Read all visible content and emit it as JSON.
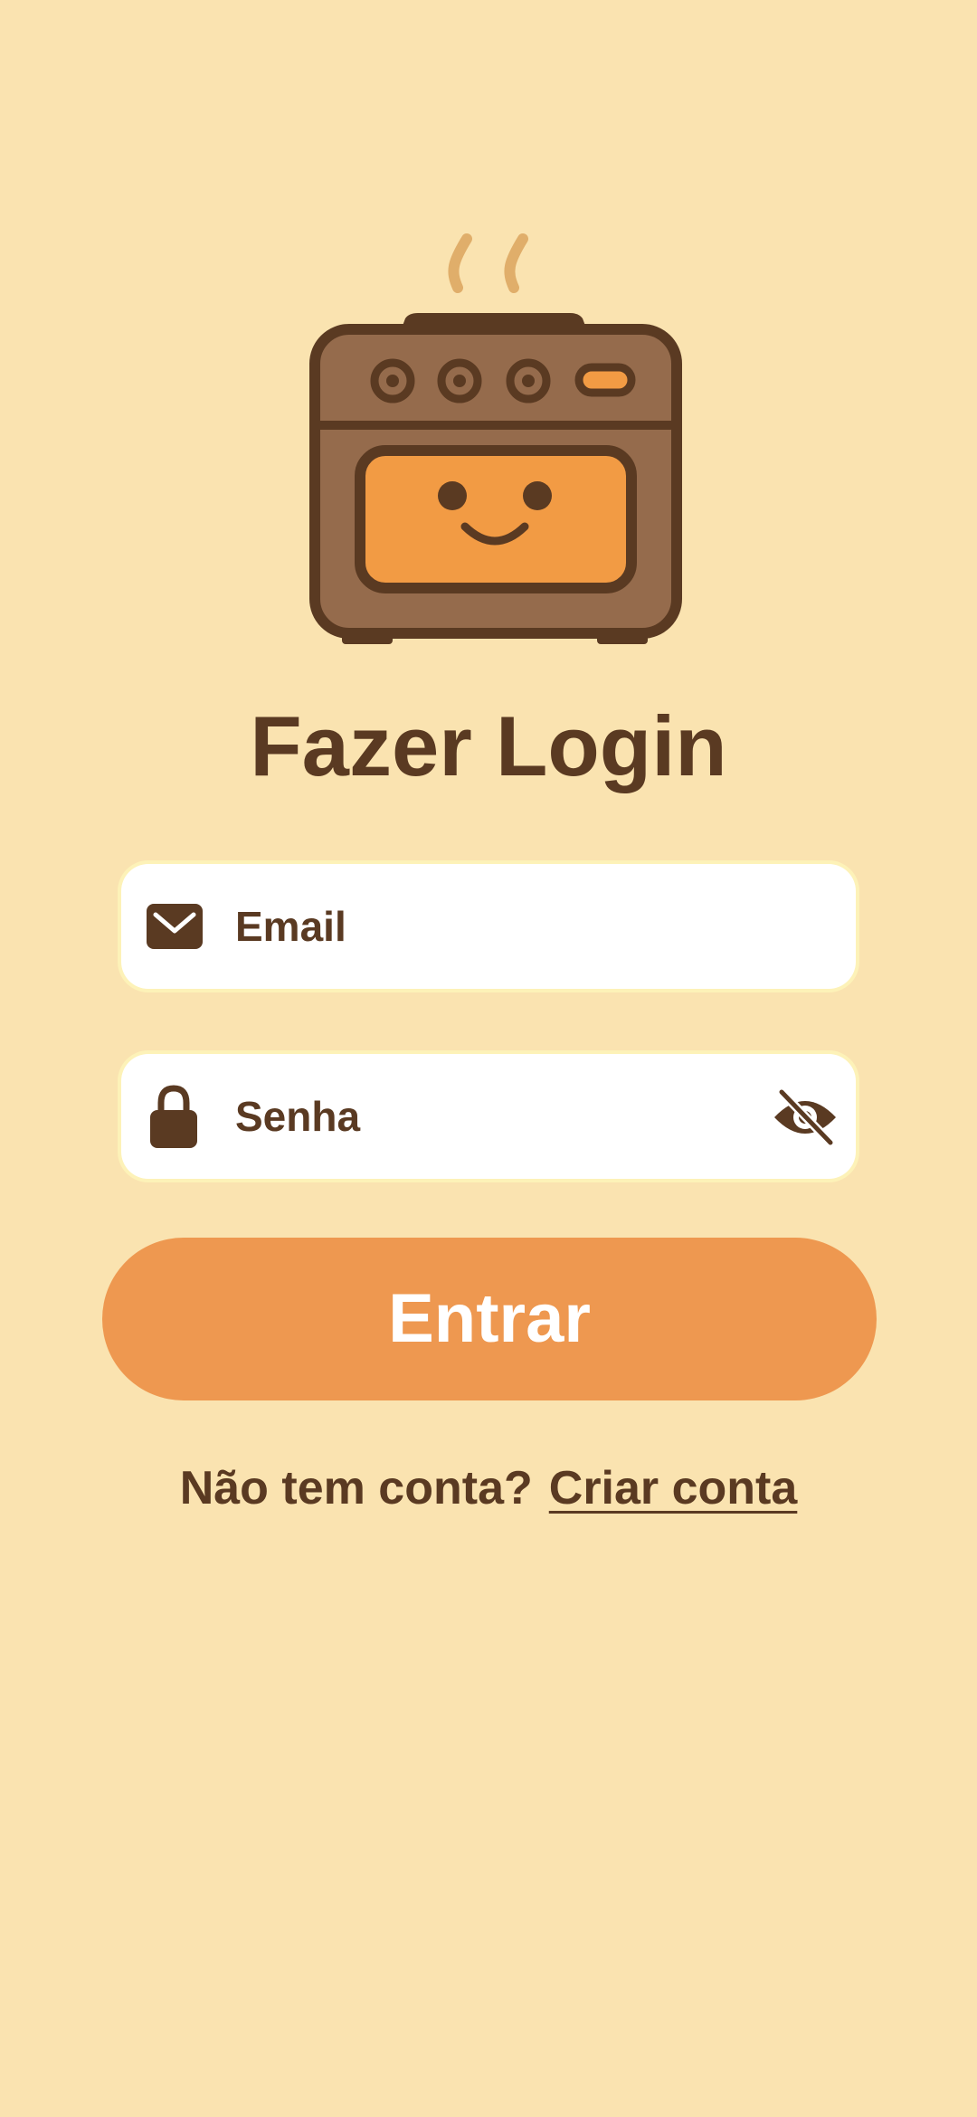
{
  "login": {
    "title": "Fazer Login",
    "email_placeholder": "Email",
    "password_placeholder": "Senha",
    "submit_label": "Entrar",
    "no_account_text": "Não tem conta?",
    "create_account_link": "Criar conta"
  },
  "icons": {
    "logo": "smiling-oven-icon",
    "email": "envelope-icon",
    "password": "lock-icon",
    "toggle_visibility": "eye-off-icon"
  },
  "colors": {
    "background": "#FAE3B0",
    "text": "#5A3A22",
    "button": "#EE9850",
    "field": "#FFFFFF"
  }
}
